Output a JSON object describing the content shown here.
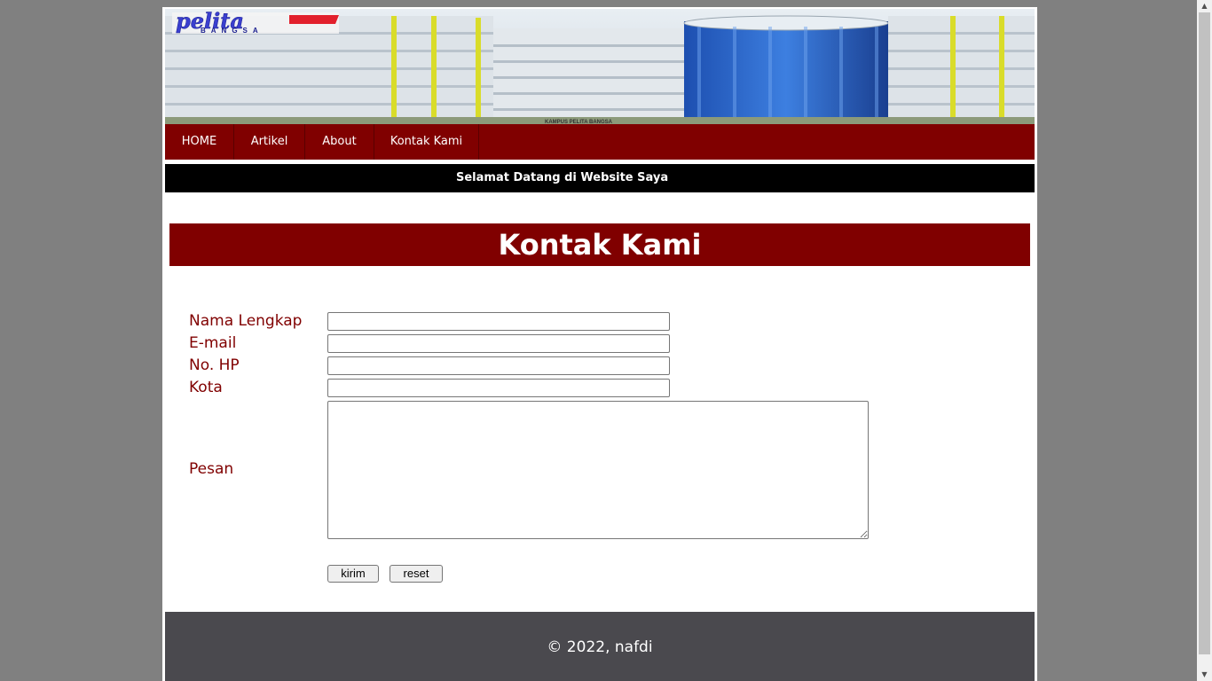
{
  "banner": {
    "logo_main": "pelita",
    "logo_sub": "BANGSA",
    "building_caption": "KAMPUS PELITA BANGSA"
  },
  "nav": {
    "items": [
      {
        "label": "HOME"
      },
      {
        "label": "Artikel"
      },
      {
        "label": "About"
      },
      {
        "label": "Kontak Kami"
      }
    ]
  },
  "welcome_text": "Selamat Datang di Website Saya",
  "heading": "Kontak Kami",
  "form": {
    "nama_label": "Nama Lengkap",
    "nama_value": "",
    "email_label": "E-mail",
    "email_value": "",
    "hp_label": "No. HP",
    "hp_value": "",
    "kota_label": "Kota",
    "kota_value": "",
    "pesan_label": "Pesan",
    "pesan_value": "",
    "submit_label": "kirim",
    "reset_label": "reset"
  },
  "footer_text": "© 2022, nafdi",
  "colors": {
    "primary": "#800000",
    "footer": "#4a494e",
    "background": "#808080"
  }
}
